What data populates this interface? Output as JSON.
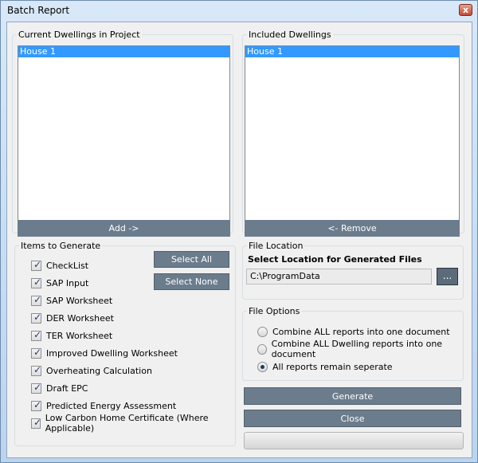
{
  "window": {
    "title": "Batch Report",
    "close_glyph": "x"
  },
  "current_dwellings": {
    "legend": "Current Dwellings in Project",
    "items": [
      {
        "label": "House 1",
        "selected": true
      }
    ],
    "add_button": "Add ->"
  },
  "included_dwellings": {
    "legend": "Included Dwellings",
    "items": [
      {
        "label": "House 1",
        "selected": true
      }
    ],
    "remove_button": "<- Remove"
  },
  "items_to_generate": {
    "legend": "Items to Generate",
    "select_all": "Select All",
    "select_none": "Select None",
    "items": [
      {
        "label": "CheckList",
        "checked": true
      },
      {
        "label": "SAP Input",
        "checked": true
      },
      {
        "label": "SAP Worksheet",
        "checked": true
      },
      {
        "label": "DER Worksheet",
        "checked": true
      },
      {
        "label": "TER Worksheet",
        "checked": true
      },
      {
        "label": "Improved Dwelling Worksheet",
        "checked": true
      },
      {
        "label": "Overheating Calculation",
        "checked": true
      },
      {
        "label": "Draft EPC",
        "checked": true
      },
      {
        "label": "Predicted Energy Assessment",
        "checked": true
      },
      {
        "label": "Low Carbon Home Certificate (Where Applicable)",
        "checked": true
      }
    ]
  },
  "file_location": {
    "legend": "File Location",
    "heading": "Select Location for Generated Files",
    "path_value": "C:\\ProgramData",
    "browse_label": "..."
  },
  "file_options": {
    "legend": "File Options",
    "options": [
      {
        "label": "Combine ALL reports into one document",
        "selected": false
      },
      {
        "label": "Combine ALL Dwelling reports into one document",
        "selected": false
      },
      {
        "label": "All reports remain seperate",
        "selected": true
      }
    ]
  },
  "actions": {
    "generate": "Generate",
    "close": "Close"
  },
  "progress": {
    "fraction": 0.0
  },
  "colors": {
    "selection": "#3399ff",
    "button_bg": "#6b7c8c",
    "title_bg": "#c7dcf3"
  },
  "icons": {
    "check": "check-icon",
    "radio": "radio-dot-icon"
  }
}
